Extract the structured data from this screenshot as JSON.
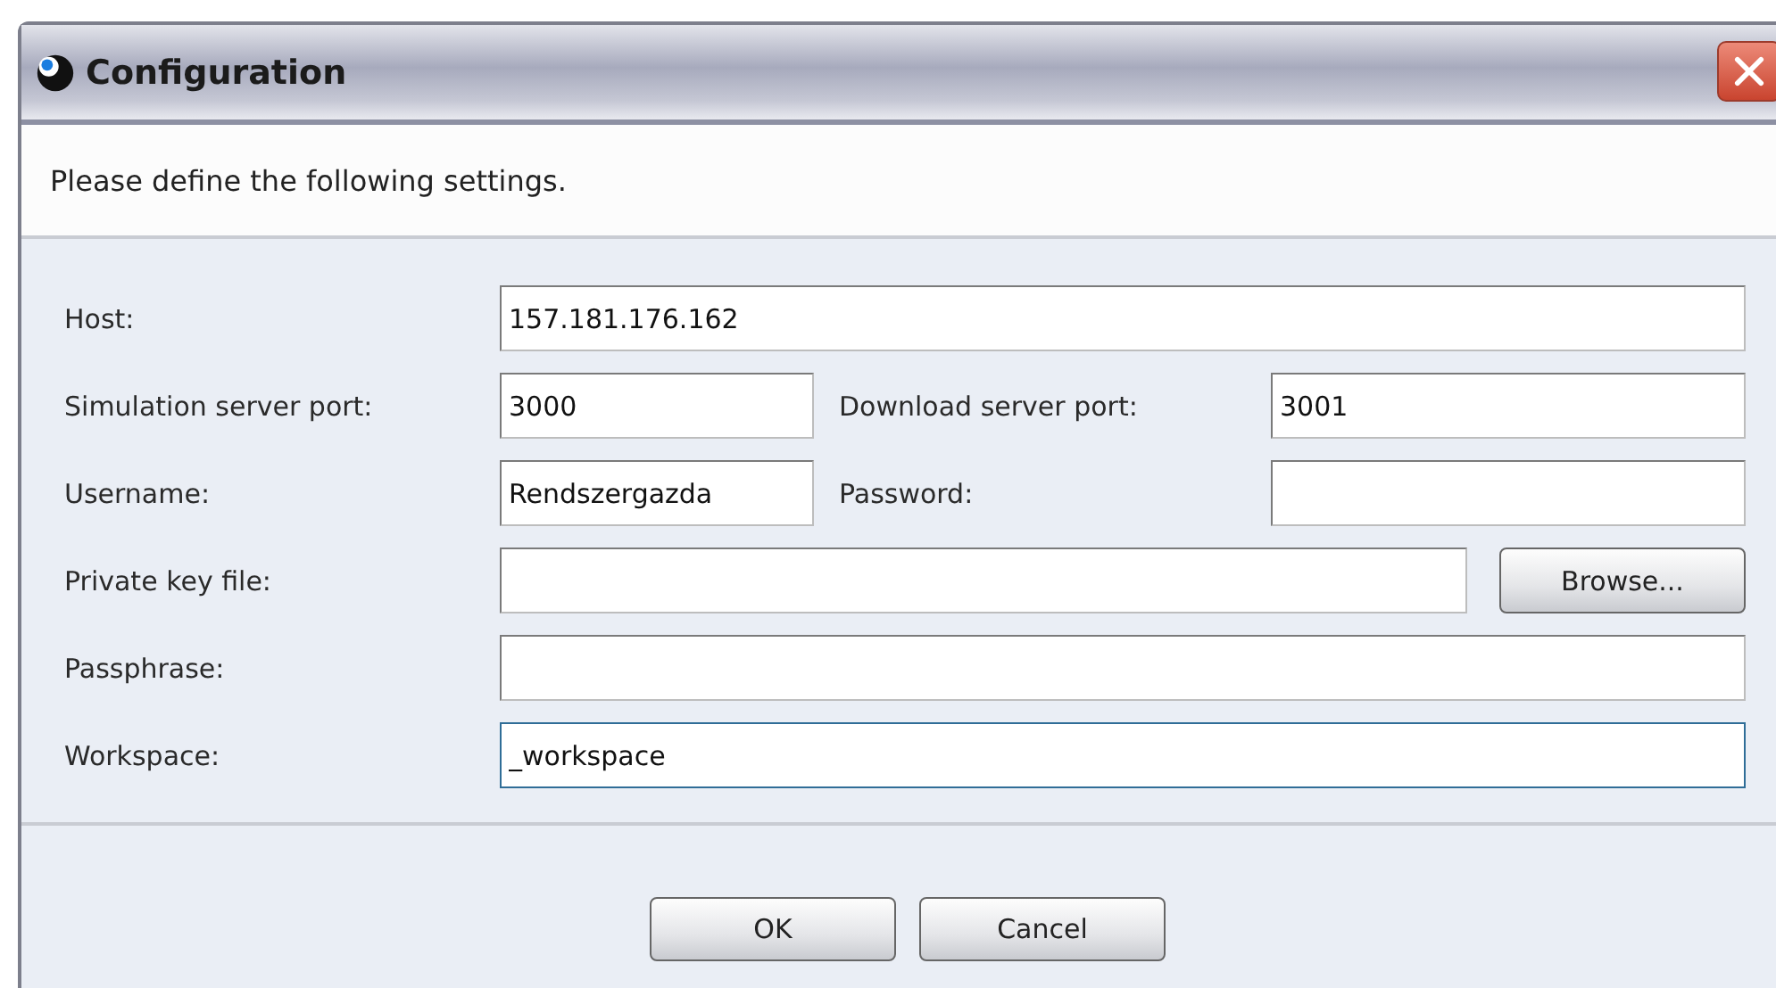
{
  "window": {
    "title": "Configuration"
  },
  "instruction": "Please define the following settings.",
  "rows": [
    {
      "kind": "full",
      "label": "Host:",
      "value": "157.181.176.162",
      "focused": false
    },
    {
      "kind": "pair",
      "items": [
        {
          "label": "Simulation server port:",
          "value": "3000",
          "focused": false
        },
        {
          "label": "Download server port:",
          "value": "3001",
          "focused": false
        }
      ]
    },
    {
      "kind": "pair",
      "items": [
        {
          "label": "Username:",
          "value": "Rendszergazda",
          "focused": false
        },
        {
          "label": "Password:",
          "focused": false
        }
      ]
    },
    {
      "kind": "browse",
      "label": "Private key file:",
      "focused": false,
      "button": "Browse..."
    },
    {
      "kind": "full",
      "label": "Passphrase:",
      "focused": false
    },
    {
      "kind": "full",
      "label": "Workspace:",
      "value": "_workspace",
      "focused": true
    }
  ],
  "buttons": [
    "OK",
    "Cancel"
  ]
}
